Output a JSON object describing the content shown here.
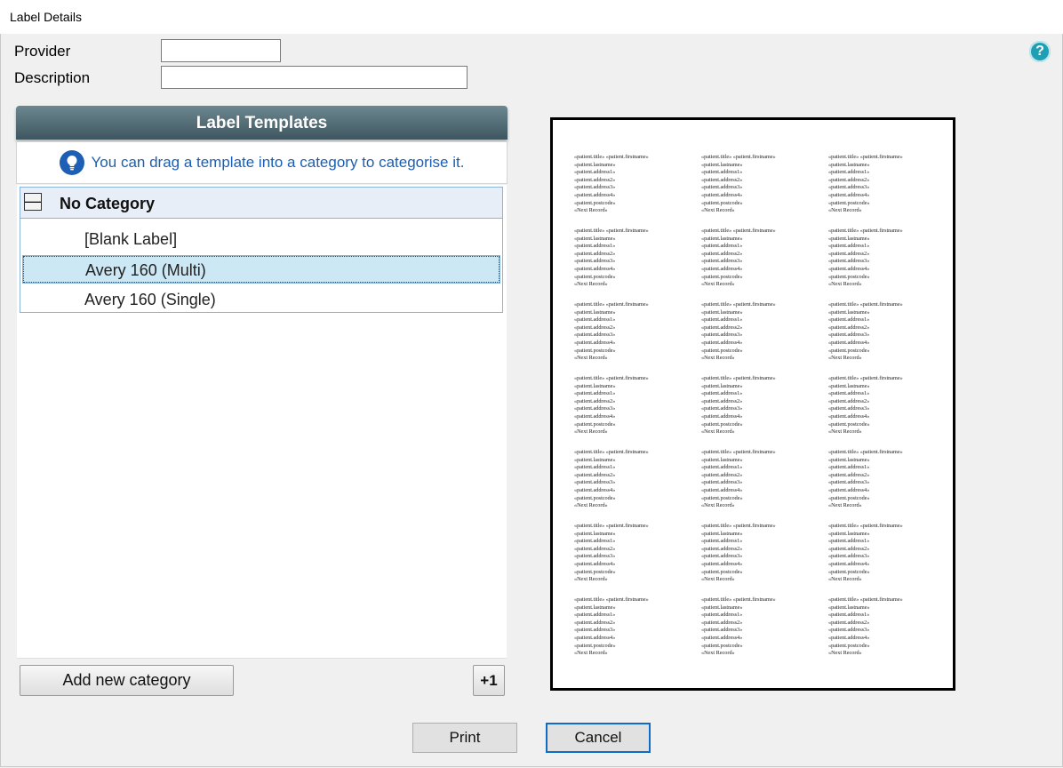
{
  "window": {
    "title": "Label Details"
  },
  "form": {
    "provider_label": "Provider",
    "provider_value": "",
    "description_label": "Description",
    "description_value": ""
  },
  "help": {
    "icon": "help-icon",
    "glyph": "?"
  },
  "templates": {
    "header": "Label Templates",
    "tip": "You can drag a template into a category to categorise it.",
    "tip_icon": "lightbulb-icon",
    "categories": [
      {
        "name": "No Category",
        "collapse_glyph": "—",
        "items": [
          "[Blank Label]",
          "Avery 160 (Multi)",
          "Avery 160 (Single)"
        ],
        "selected": "Avery 160 (Multi)"
      }
    ]
  },
  "buttons": {
    "add_category": "Add new category",
    "plus_one": "+1",
    "print": "Print",
    "cancel": "Cancel"
  },
  "preview": {
    "label_lines": [
      "«patient.title» «patient.firstname»",
      "«patient.lastname»",
      "«patient.address1»",
      "«patient.address2»",
      "«patient.address3»",
      "«patient.address4»",
      "«patient.postcode»",
      "«Next Record»"
    ]
  }
}
